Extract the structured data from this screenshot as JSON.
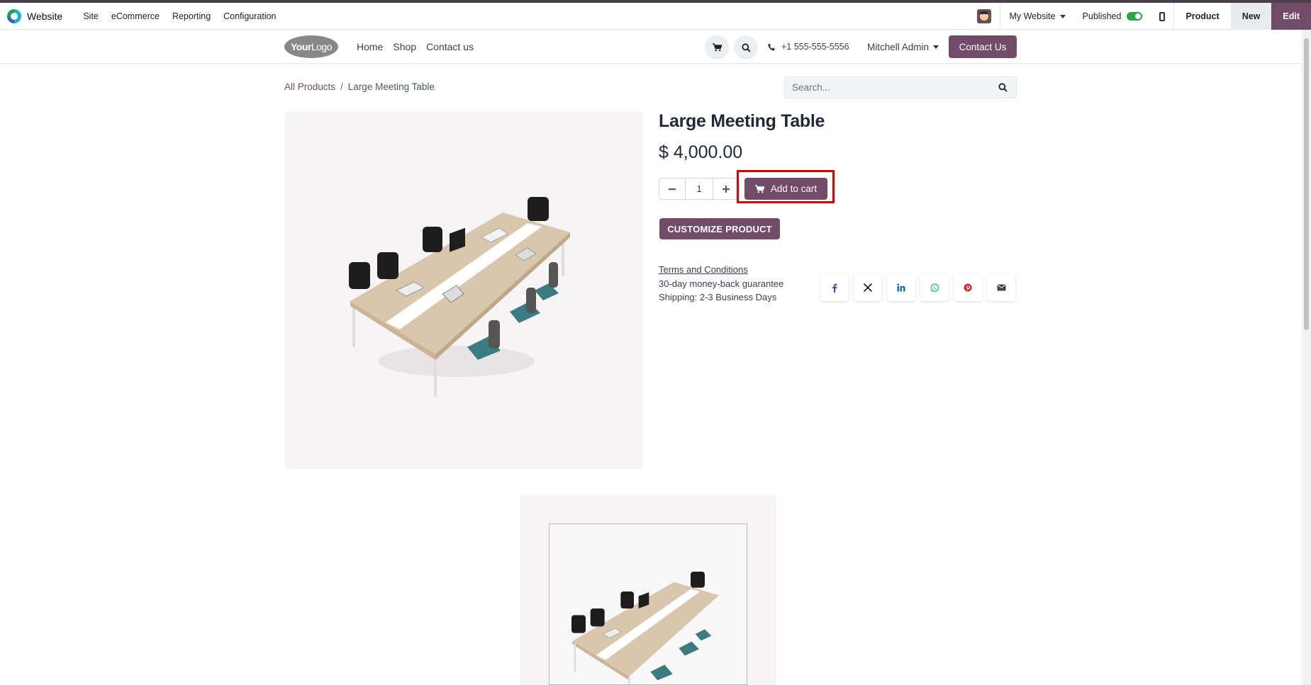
{
  "backend": {
    "app_name": "Website",
    "menu": [
      "Site",
      "eCommerce",
      "Reporting",
      "Configuration"
    ],
    "website_selector": "My Website",
    "published_label": "Published",
    "product_label": "Product",
    "new_label": "New",
    "edit_label": "Edit"
  },
  "site_header": {
    "logo_bold": "Your",
    "logo_rest": "Logo",
    "nav": [
      "Home",
      "Shop",
      "Contact us"
    ],
    "phone": "+1 555-555-5556",
    "user": "Mitchell Admin",
    "contact_button": "Contact Us"
  },
  "breadcrumb": {
    "parent": "All Products",
    "separator": "/",
    "current": "Large Meeting Table"
  },
  "search": {
    "placeholder": "Search..."
  },
  "product": {
    "title": "Large Meeting Table",
    "price": "$ 4,000.00",
    "quantity": "1",
    "add_to_cart": "Add to cart",
    "customize": "CUSTOMIZE PRODUCT",
    "terms_link": "Terms and Conditions",
    "guarantee": "30-day money-back guarantee",
    "shipping": "Shipping: 2-3 Business Days"
  },
  "share_icons": [
    "facebook-icon",
    "x-icon",
    "linkedin-icon",
    "whatsapp-icon",
    "pinterest-icon",
    "email-icon"
  ],
  "colors": {
    "brand": "#714b67",
    "highlight": "#e10000",
    "published_toggle": "#28a745"
  }
}
